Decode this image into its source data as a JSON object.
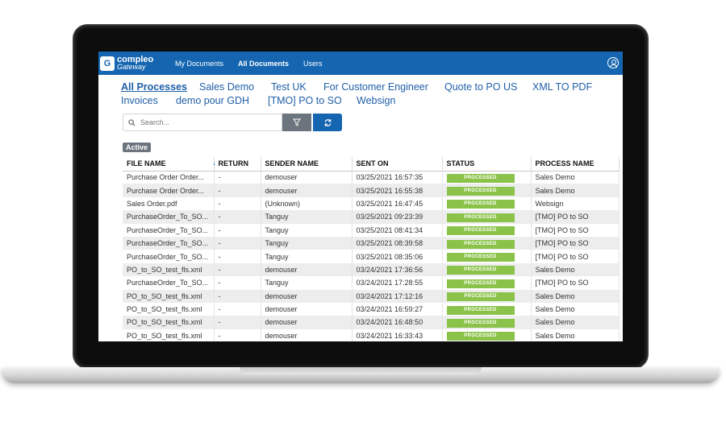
{
  "app": {
    "logo_line1": "compleo",
    "logo_line2": "Gateway",
    "logo_mark": "G"
  },
  "nav": {
    "items": [
      {
        "label": "My Documents",
        "active": false
      },
      {
        "label": "All Documents",
        "active": true
      },
      {
        "label": "Users",
        "active": false
      }
    ]
  },
  "process_tabs": [
    {
      "label": "All Processes",
      "active": true
    },
    {
      "label": "Sales Demo",
      "active": false
    },
    {
      "label": "Test UK",
      "active": false
    },
    {
      "label": "For Customer Engineer",
      "active": false
    },
    {
      "label": "Quote to PO US",
      "active": false
    },
    {
      "label": "XML TO PDF",
      "active": false
    },
    {
      "label": "Invoices",
      "active": false
    },
    {
      "label": "demo pour GDH",
      "active": false
    },
    {
      "label": "[TMO] PO to SO",
      "active": false
    },
    {
      "label": "Websign",
      "active": false
    }
  ],
  "search": {
    "placeholder": "Search...",
    "value": ""
  },
  "filter_badge": "Active",
  "table": {
    "columns": [
      "FILE NAME",
      "RETURN",
      "SENDER NAME",
      "SENT ON",
      "STATUS",
      "PROCESS NAME"
    ],
    "sort_indicator": "↓",
    "rows": [
      {
        "file": "Purchase Order Order...",
        "ret": "-",
        "sender": "demouser",
        "sent": "03/25/2021 16:57:35",
        "status": "PROCESSED",
        "process": "Sales Demo"
      },
      {
        "file": "Purchase Order Order...",
        "ret": "-",
        "sender": "demouser",
        "sent": "03/25/2021 16:55:38",
        "status": "PROCESSED",
        "process": "Sales Demo"
      },
      {
        "file": "Sales Order.pdf",
        "ret": "-",
        "sender": "(Unknown)",
        "sent": "03/25/2021 16:47:45",
        "status": "PROCESSED",
        "process": "Websign"
      },
      {
        "file": "PurchaseOrder_To_SO...",
        "ret": "-",
        "sender": "Tanguy",
        "sent": "03/25/2021 09:23:39",
        "status": "PROCESSED",
        "process": "[TMO] PO to SO"
      },
      {
        "file": "PurchaseOrder_To_SO...",
        "ret": "-",
        "sender": "Tanguy",
        "sent": "03/25/2021 08:41:34",
        "status": "PROCESSED",
        "process": "[TMO] PO to SO"
      },
      {
        "file": "PurchaseOrder_To_SO...",
        "ret": "-",
        "sender": "Tanguy",
        "sent": "03/25/2021 08:39:58",
        "status": "PROCESSED",
        "process": "[TMO] PO to SO"
      },
      {
        "file": "PurchaseOrder_To_SO...",
        "ret": "-",
        "sender": "Tanguy",
        "sent": "03/25/2021 08:35:06",
        "status": "PROCESSED",
        "process": "[TMO] PO to SO"
      },
      {
        "file": "PO_to_SO_test_fls.xml",
        "ret": "-",
        "sender": "demouser",
        "sent": "03/24/2021 17:36:56",
        "status": "PROCESSED",
        "process": "Sales Demo"
      },
      {
        "file": "PurchaseOrder_To_SO...",
        "ret": "-",
        "sender": "Tanguy",
        "sent": "03/24/2021 17:28:55",
        "status": "PROCESSED",
        "process": "[TMO] PO to SO"
      },
      {
        "file": "PO_to_SO_test_fls.xml",
        "ret": "-",
        "sender": "demouser",
        "sent": "03/24/2021 17:12:16",
        "status": "PROCESSED",
        "process": "Sales Demo"
      },
      {
        "file": "PO_to_SO_test_fls.xml",
        "ret": "-",
        "sender": "demouser",
        "sent": "03/24/2021 16:59:27",
        "status": "PROCESSED",
        "process": "Sales Demo"
      },
      {
        "file": "PO_to_SO_test_fls.xml",
        "ret": "-",
        "sender": "demouser",
        "sent": "03/24/2021 16:48:50",
        "status": "PROCESSED",
        "process": "Sales Demo"
      },
      {
        "file": "PO_to_SO_test_fls.xml",
        "ret": "-",
        "sender": "demouser",
        "sent": "03/24/2021 16:33:43",
        "status": "PROCESSED",
        "process": "Sales Demo"
      }
    ]
  },
  "colors": {
    "brand_blue": "#1565b0",
    "status_processed": "#8bc34a",
    "link_blue": "#1f5fa8"
  },
  "icons": [
    "user-icon",
    "search-icon",
    "filter-icon",
    "refresh-icon"
  ]
}
